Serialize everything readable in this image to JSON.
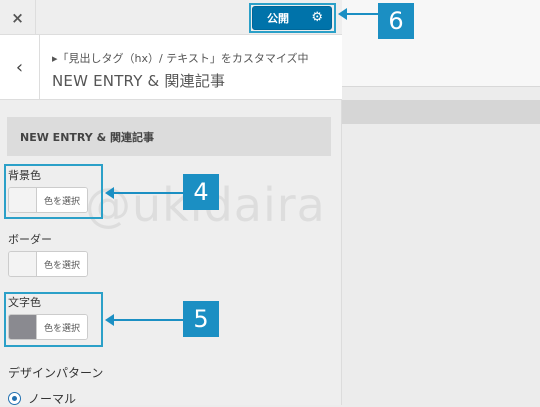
{
  "header": {
    "close_icon": "×",
    "publish_label": "公開",
    "publish_gear": "⚙"
  },
  "section": {
    "back_icon": "‹",
    "breadcrumb": "▸「見出しタグ（hx）/ テキスト」をカスタマイズ中",
    "title": "NEW ENTRY & 関連記事"
  },
  "content": {
    "heading": "NEW ENTRY & 関連記事",
    "controls": [
      {
        "label": "背景色",
        "button_label": "色を選択",
        "swatch_color": "#f3f3f3"
      },
      {
        "label": "ボーダー",
        "button_label": "色を選択",
        "swatch_color": "#f3f3f3"
      },
      {
        "label": "文字色",
        "button_label": "色を選択",
        "swatch_color": "#8a8a90"
      }
    ],
    "pattern_label": "デザインパターン",
    "pattern_option": "ノーマル"
  },
  "watermark": "@ukidaira",
  "callouts": [
    "6",
    "4",
    "5"
  ],
  "colors": {
    "accent": "#0073aa",
    "callout": "#1b8fc3"
  }
}
